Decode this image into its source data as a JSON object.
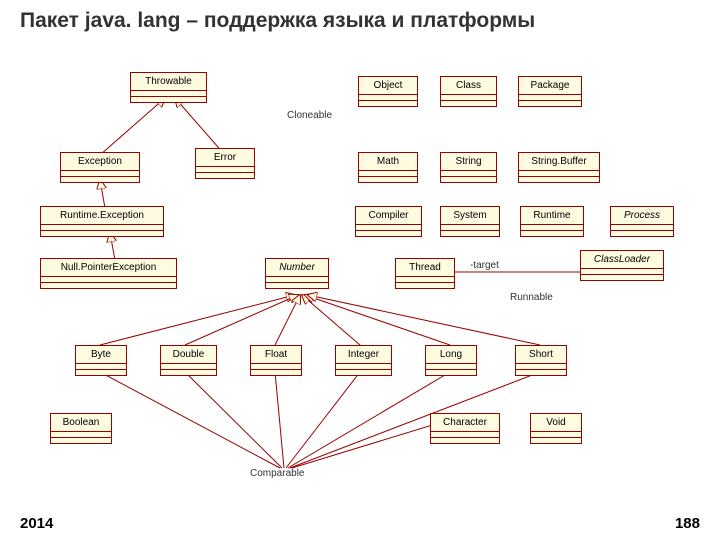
{
  "title": "Пакет java. lang – поддержка языка и платформы",
  "footer": {
    "year": "2014",
    "page": "188"
  },
  "labels": {
    "cloneable": "Cloneable",
    "runnable": "Runnable",
    "comparable": "Comparable",
    "target": "-target"
  },
  "boxes": {
    "throwable": "Throwable",
    "object": "Object",
    "class": "Class",
    "package": "Package",
    "exception": "Exception",
    "error": "Error",
    "math": "Math",
    "string": "String",
    "stringbuffer": "String.Buffer",
    "runtimeexc": "Runtime.Exception",
    "compiler": "Compiler",
    "system": "System",
    "runtime": "Runtime",
    "process": "Process",
    "npe": "Null.PointerException",
    "number": "Number",
    "thread": "Thread",
    "classloader": "ClassLoader",
    "byte": "Byte",
    "double": "Double",
    "float": "Float",
    "integer": "Integer",
    "long": "Long",
    "short": "Short",
    "boolean": "Boolean",
    "character": "Character",
    "void": "Void"
  }
}
